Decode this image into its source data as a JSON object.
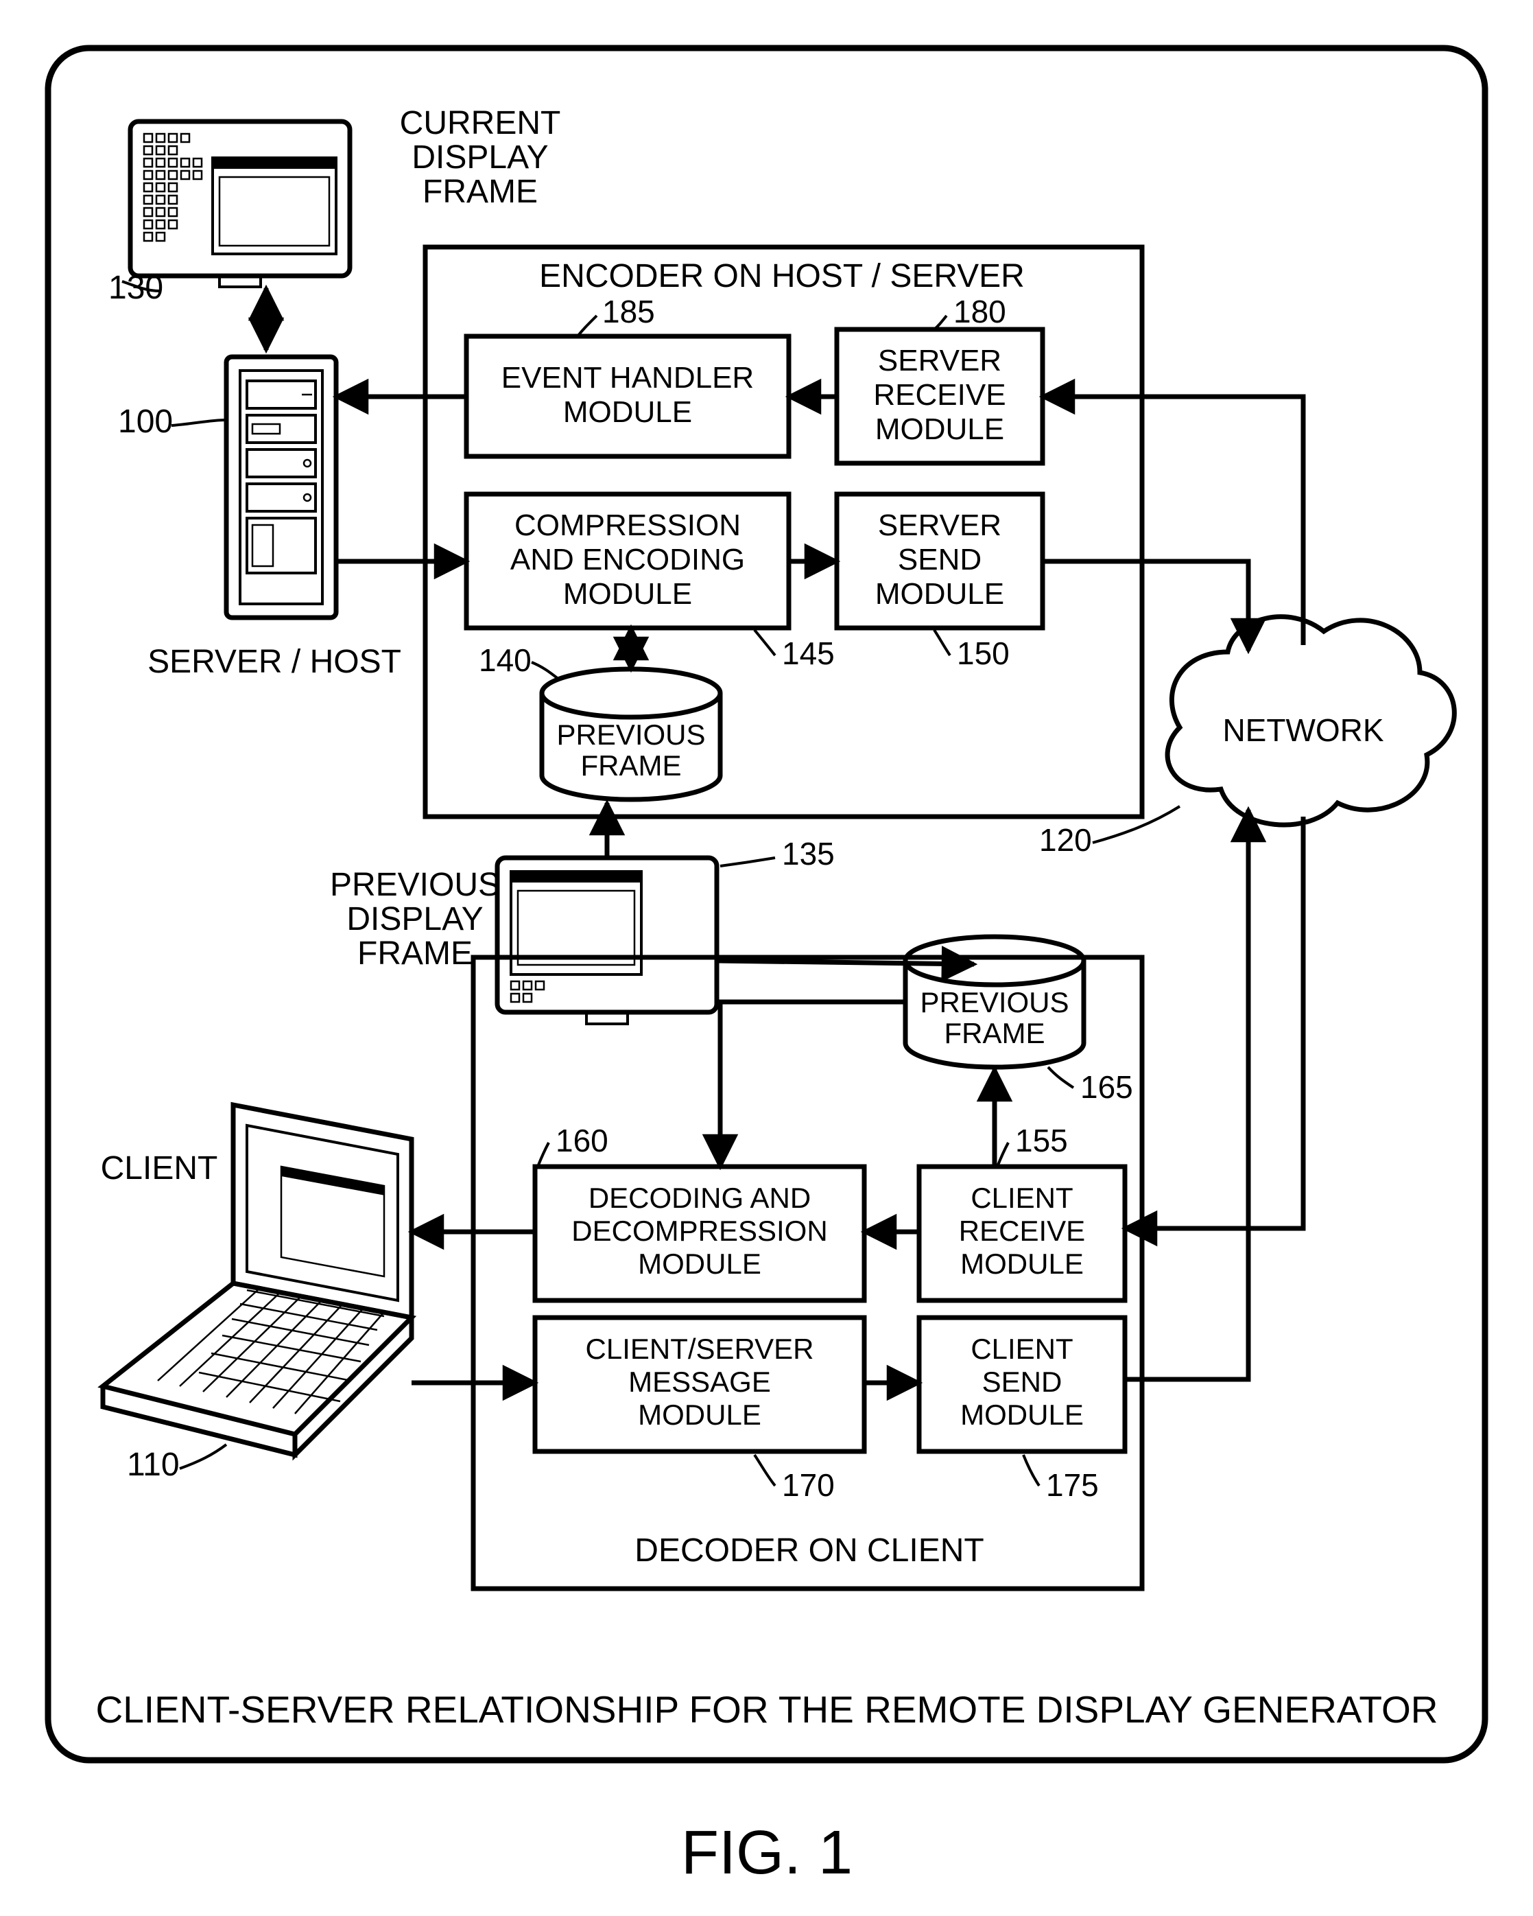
{
  "figure_label": "FIG. 1",
  "caption": "CLIENT-SERVER RELATIONSHIP FOR THE REMOTE DISPLAY GENERATOR",
  "encoder_title": "ENCODER ON HOST / SERVER",
  "decoder_title": "DECODER ON CLIENT",
  "server_host_label": "SERVER / HOST",
  "client_label": "CLIENT",
  "network_label": "NETWORK",
  "current_display_frame_l1": "CURRENT",
  "current_display_frame_l2": "DISPLAY",
  "current_display_frame_l3": "FRAME",
  "previous_display_frame_l1": "PREVIOUS",
  "previous_display_frame_l2": "DISPLAY",
  "previous_display_frame_l3": "FRAME",
  "event_handler_l1": "EVENT HANDLER",
  "event_handler_l2": "MODULE",
  "server_receive_l1": "SERVER",
  "server_receive_l2": "RECEIVE",
  "server_receive_l3": "MODULE",
  "compression_l1": "COMPRESSION",
  "compression_l2": "AND ENCODING",
  "compression_l3": "MODULE",
  "server_send_l1": "SERVER",
  "server_send_l2": "SEND",
  "server_send_l3": "MODULE",
  "prev_frame_l1": "PREVIOUS",
  "prev_frame_l2": "FRAME",
  "decoding_l1": "DECODING AND",
  "decoding_l2": "DECOMPRESSION",
  "decoding_l3": "MODULE",
  "client_receive_l1": "CLIENT",
  "client_receive_l2": "RECEIVE",
  "client_receive_l3": "MODULE",
  "client_msg_l1": "CLIENT/SERVER",
  "client_msg_l2": "MESSAGE",
  "client_msg_l3": "MODULE",
  "client_send_l1": "CLIENT",
  "client_send_l2": "SEND",
  "client_send_l3": "MODULE",
  "ref": {
    "r100": "100",
    "r110": "110",
    "r120": "120",
    "r130": "130",
    "r135": "135",
    "r140": "140",
    "r145": "145",
    "r150": "150",
    "r155": "155",
    "r160": "160",
    "r165": "165",
    "r170": "170",
    "r175": "175",
    "r180": "180",
    "r185": "185"
  }
}
